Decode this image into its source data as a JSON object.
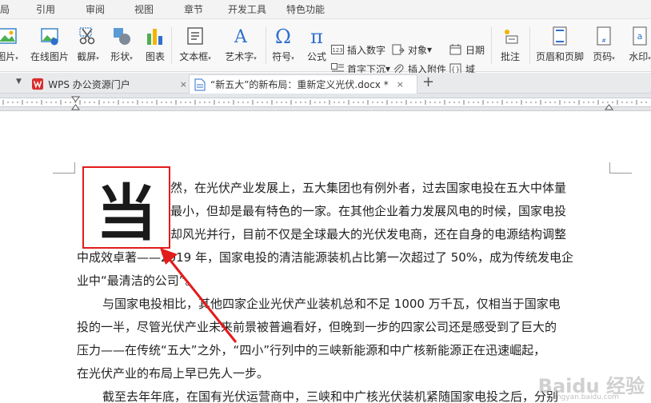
{
  "menu": {
    "items": [
      "局",
      "引用",
      "审阅",
      "视图",
      "章节",
      "开发工具",
      "特色功能"
    ]
  },
  "ribbon": {
    "picture": "图片",
    "online_picture": "在线图片",
    "screenshot": "截屏",
    "shape": "形状",
    "chart": "图表",
    "textbox": "文本框",
    "wordart": "艺术字",
    "symbol": "符号",
    "formula": "公式",
    "insert_number": "插入数字",
    "object": "对象",
    "date": "日期",
    "dropcap": "首字下沉",
    "attachment": "插入附件",
    "field": "域",
    "comment": "批注",
    "header_footer": "页眉和页脚",
    "page_number": "页码",
    "watermark": "水印"
  },
  "tabs": {
    "wps_tab": "WPS 办公资源门户",
    "doc_tab": "“新五大”的新布局：重新定义光伏.docx *",
    "close": "×",
    "add": "+"
  },
  "document": {
    "dropcap_char": "当",
    "lines": [
      "然，在光伏产业发展上，五大集团也有例外者，过去国家电投在五大中体量",
      "最小，但却是最有特色的一家。在其他企业着力发展风电的时候，国家电投",
      "却风光并行，目前不仅是全球最大的光伏发电商，还在自身的电源结构调整",
      "中成效卓著——2019 年，国家电投的清洁能源装机占比第一次超过了 50%，成为传统发电企",
      "业中“最清洁的公司”。",
      "与国家电投相比，其他四家企业光伏产业装机总和不足 1000 万千瓦，仅相当于国家电",
      "投的一半，尽管光伏产业未来前景被普遍看好，但晚到一步的四家公司还是感受到了巨大的",
      "压力——在传统“五大”之外，“四小”行列中的三峡新能源和中广核新能源正在迅速崛起，",
      "在光伏产业的布局上早已先人一步。",
      "截至去年年底，在国有光伏运营商中，三峡和中广核光伏装机紧随国家电投之后，分别"
    ]
  },
  "watermark": {
    "text": "Baidu 经验",
    "sub": "jingyan.baidu.com"
  },
  "colors": {
    "highlight": "#e21b1b",
    "wps_red": "#d92c2c",
    "accent_blue": "#2f6fce"
  }
}
